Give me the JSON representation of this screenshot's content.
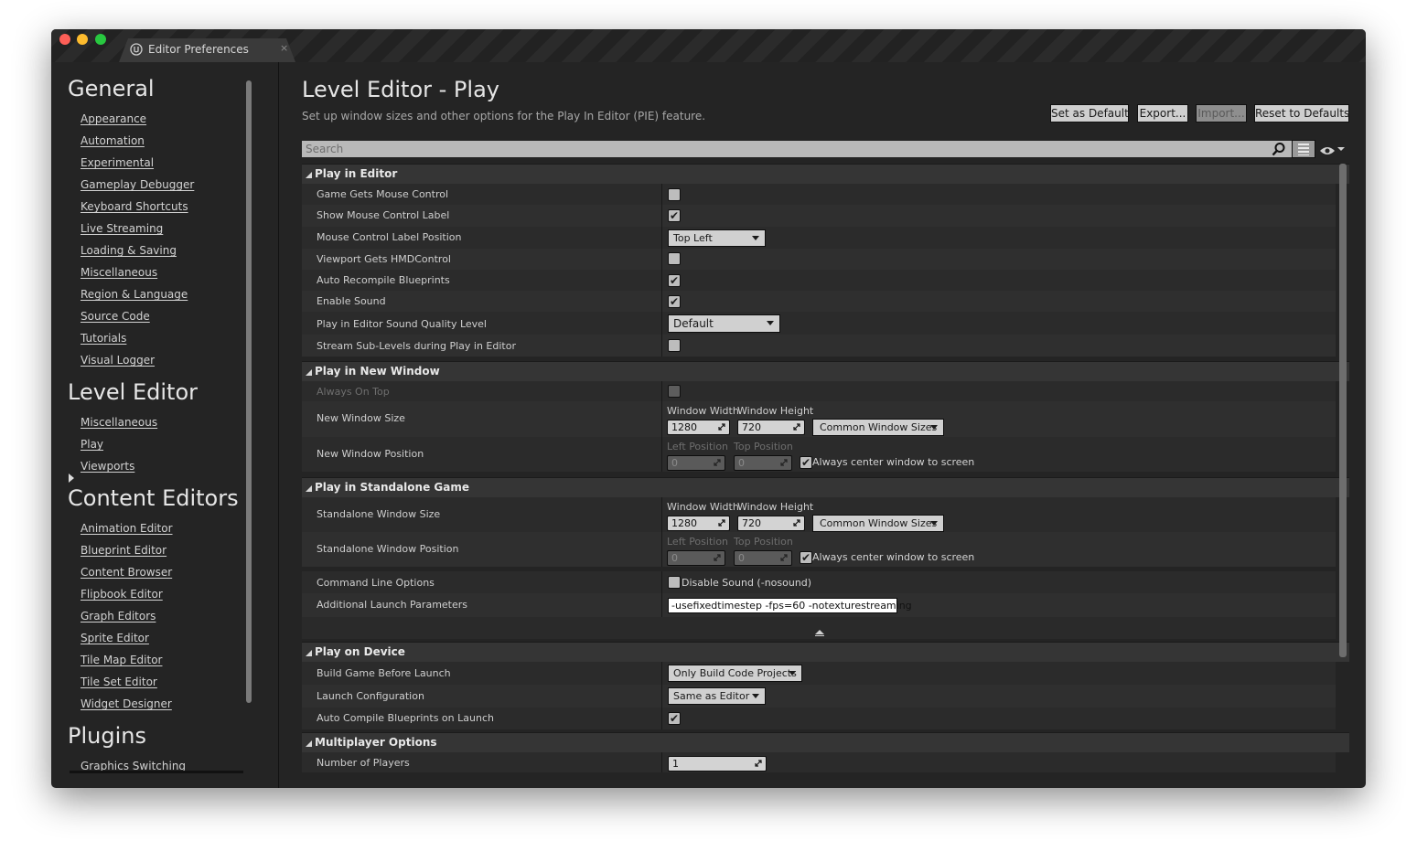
{
  "window": {
    "tab_title": "Editor Preferences",
    "tab_close": "×",
    "traffic_lights": {
      "close": "#fe5f57",
      "minimize": "#febc2e",
      "zoom": "#28c840"
    }
  },
  "sidebar": {
    "sections": [
      {
        "title": "General",
        "items": [
          "Appearance",
          "Automation",
          "Experimental",
          "Gameplay Debugger",
          "Keyboard Shortcuts",
          "Live Streaming",
          "Loading & Saving",
          "Miscellaneous",
          "Region & Language",
          "Source Code",
          "Tutorials",
          "Visual Logger"
        ]
      },
      {
        "title": "Level Editor",
        "items": [
          "Miscellaneous",
          "Play",
          "Viewports"
        ]
      },
      {
        "title": "Content Editors",
        "items": [
          "Animation Editor",
          "Blueprint Editor",
          "Content Browser",
          "Flipbook Editor",
          "Graph Editors",
          "Sprite Editor",
          "Tile Map Editor",
          "Tile Set Editor",
          "Widget Designer"
        ]
      },
      {
        "title": "Plugins",
        "items": [
          "Graphics Switching"
        ]
      }
    ],
    "selected": "Play"
  },
  "header": {
    "title": "Level Editor - Play",
    "description": "Set up window sizes and other options for the Play In Editor (PIE) feature.",
    "buttons": {
      "set_default": "Set as Default",
      "export": "Export...",
      "import": "Import...",
      "reset": "Reset to Defaults"
    }
  },
  "search": {
    "placeholder": "Search"
  },
  "icons": {
    "search": "search-icon",
    "view_options": "list-view-icon",
    "visibility": "eye-icon",
    "check": "✔"
  },
  "categories": {
    "play_in_editor": {
      "label": "Play in Editor",
      "rows": {
        "game_gets_mouse": {
          "label": "Game Gets Mouse Control",
          "checked": false
        },
        "show_mouse_label": {
          "label": "Show Mouse Control Label",
          "checked": true
        },
        "mouse_label_position": {
          "label": "Mouse Control Label Position",
          "value": "Top Left"
        },
        "viewport_hmd": {
          "label": "Viewport Gets HMDControl",
          "checked": false
        },
        "auto_recompile": {
          "label": "Auto Recompile Blueprints",
          "checked": true
        },
        "enable_sound": {
          "label": "Enable Sound",
          "checked": true
        },
        "sound_quality": {
          "label": "Play in Editor Sound Quality Level",
          "value": "Default"
        },
        "stream_sublevels": {
          "label": "Stream Sub-Levels during Play in Editor",
          "checked": false
        }
      }
    },
    "play_in_new_window": {
      "label": "Play in New Window",
      "rows": {
        "always_on_top": {
          "label": "Always On Top",
          "checked": false
        },
        "window_size": {
          "label": "New Window Size",
          "width_label": "Window Width",
          "height_label": "Window Height",
          "width": "1280",
          "height": "720",
          "preset": "Common Window Sizes"
        },
        "window_position": {
          "label": "New Window Position",
          "left_label": "Left Position",
          "top_label": "Top Position",
          "left": "0",
          "top": "0",
          "center_label": "Always center window to screen",
          "center_checked": true
        }
      }
    },
    "play_in_standalone": {
      "label": "Play in Standalone Game",
      "rows": {
        "window_size": {
          "label": "Standalone Window Size",
          "width_label": "Window Width",
          "height_label": "Window Height",
          "width": "1280",
          "height": "720",
          "preset": "Common Window Sizes"
        },
        "window_position": {
          "label": "Standalone Window Position",
          "left_label": "Left Position",
          "top_label": "Top Position",
          "left": "0",
          "top": "0",
          "center_label": "Always center window to screen",
          "center_checked": true
        },
        "command_line": {
          "label": "Command Line Options",
          "option_label": "Disable Sound (-nosound)",
          "checked": false
        },
        "launch_params": {
          "label": "Additional Launch Parameters",
          "value": "-usefixedtimestep -fps=60 -notexturestreaming"
        }
      }
    },
    "play_on_device": {
      "label": "Play on Device",
      "rows": {
        "build_before_launch": {
          "label": "Build Game Before Launch",
          "value": "Only Build Code Projects"
        },
        "launch_config": {
          "label": "Launch Configuration",
          "value": "Same as Editor"
        },
        "auto_compile": {
          "label": "Auto Compile Blueprints on Launch",
          "checked": true
        }
      }
    },
    "multiplayer": {
      "label": "Multiplayer Options",
      "rows": {
        "num_players": {
          "label": "Number of Players",
          "value": "1"
        }
      }
    }
  }
}
